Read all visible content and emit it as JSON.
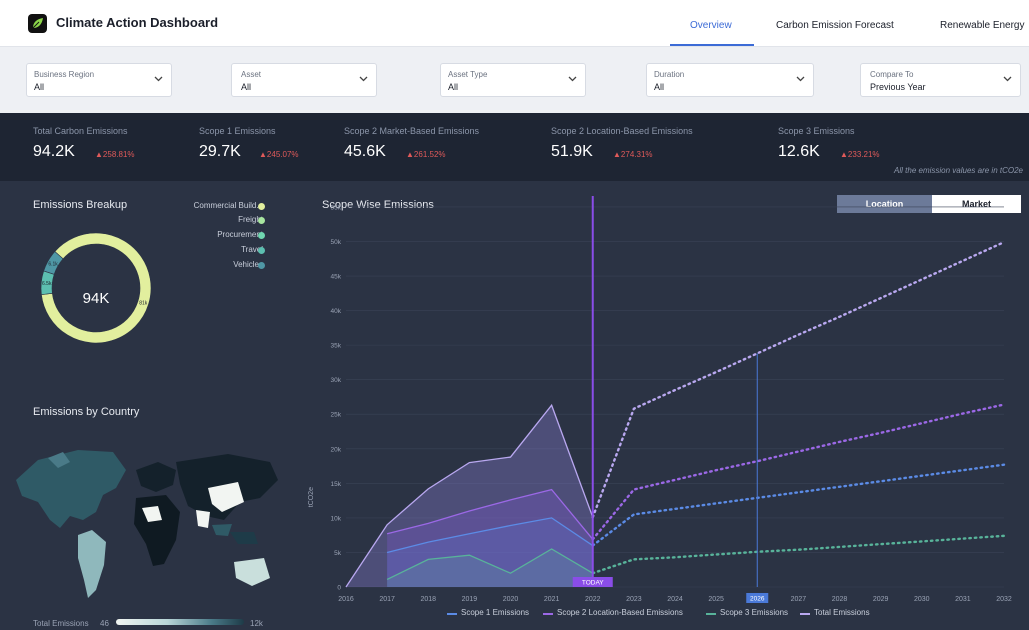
{
  "app": {
    "title": "Climate Action Dashboard"
  },
  "nav": {
    "tabs": [
      {
        "label": "Overview",
        "active": true
      },
      {
        "label": "Carbon Emission Forecast",
        "active": false
      },
      {
        "label": "Renewable Energy",
        "active": false
      }
    ]
  },
  "filters": [
    {
      "label": "Business Region",
      "value": "All"
    },
    {
      "label": "Asset",
      "value": "All"
    },
    {
      "label": "Asset Type",
      "value": "All"
    },
    {
      "label": "Duration",
      "value": "All"
    },
    {
      "label": "Compare To",
      "value": "Previous Year"
    }
  ],
  "kpis": [
    {
      "label": "Total Carbon Emissions",
      "value": "94.2K",
      "change": "▲258.81%"
    },
    {
      "label": "Scope 1 Emissions",
      "value": "29.7K",
      "change": "▲245.07%"
    },
    {
      "label": "Scope 2 Market-Based Emissions",
      "value": "45.6K",
      "change": "▲261.52%"
    },
    {
      "label": "Scope 2 Location-Based Emissions",
      "value": "51.9K",
      "change": "▲274.31%"
    },
    {
      "label": "Scope 3 Emissions",
      "value": "12.6K",
      "change": "▲233.21%"
    }
  ],
  "kpi_note": "All the emission values are in tCO2e",
  "breakup": {
    "title": "Emissions Breakup",
    "center_value": "94K",
    "segments": [
      {
        "name": "Commercial Build...",
        "value": 81,
        "label": "81k",
        "color": "#e2ef9e"
      },
      {
        "name": "Freight",
        "value": 0,
        "label": "",
        "color": "#a8e6a0"
      },
      {
        "name": "Procurement",
        "value": 0,
        "label": "",
        "color": "#6fd6b0"
      },
      {
        "name": "Travel",
        "value": 6.5,
        "label": "6.5k",
        "color": "#5cbfb0"
      },
      {
        "name": "Vehicles",
        "value": 6.1,
        "label": "6.1k",
        "color": "#4f97a5"
      }
    ]
  },
  "country": {
    "title": "Emissions by Country",
    "legend_label": "Total Emissions",
    "min": "46",
    "max": "12k"
  },
  "scope_chart": {
    "title": "Scope Wise Emissions",
    "toggle": {
      "active": "Location",
      "inactive": "Market"
    },
    "today_label": "TODAY",
    "marker_label": "2026"
  },
  "chart_data": {
    "type": "line",
    "title": "Scope Wise Emissions",
    "ylabel": "tCO2e",
    "ylim": [
      0,
      56000
    ],
    "y_ticks": [
      "0",
      "5k",
      "10k",
      "15k",
      "20k",
      "25k",
      "30k",
      "35k",
      "40k",
      "45k",
      "50k",
      "55k"
    ],
    "y_tick_values": [
      0,
      5000,
      10000,
      15000,
      20000,
      25000,
      30000,
      35000,
      40000,
      45000,
      50000,
      55000
    ],
    "x": [
      2016,
      2017,
      2018,
      2019,
      2020,
      2021,
      2022,
      2023,
      2024,
      2025,
      2026,
      2027,
      2028,
      2029,
      2030,
      2031,
      2032
    ],
    "today": 2022,
    "marker": 2026,
    "series": [
      {
        "name": "Scope 1 Emissions",
        "color": "#5b8be6",
        "values": [
          null,
          5000,
          6500,
          7700,
          8900,
          10000,
          6000,
          10500,
          11300,
          12100,
          12900,
          13700,
          14500,
          15300,
          16100,
          16900,
          17700
        ]
      },
      {
        "name": "Scope 2 Location-Based Emissions",
        "color": "#9b68e6",
        "values": [
          null,
          7700,
          9200,
          11000,
          12600,
          14100,
          6900,
          14100,
          15500,
          16900,
          18200,
          19600,
          21000,
          22300,
          23700,
          25100,
          26400
        ]
      },
      {
        "name": "Scope 3 Emissions",
        "color": "#58b39a",
        "values": [
          null,
          1100,
          4000,
          4600,
          2000,
          5500,
          2000,
          4000,
          4300,
          4700,
          5100,
          5400,
          5800,
          6200,
          6600,
          7000,
          7400
        ]
      },
      {
        "name": "Total Emissions",
        "color": "#b9a8f0",
        "values": [
          0,
          9000,
          14200,
          18000,
          18800,
          26300,
          10100,
          25800,
          28500,
          31100,
          33800,
          36500,
          39100,
          41800,
          44500,
          47200,
          49900
        ]
      }
    ]
  }
}
